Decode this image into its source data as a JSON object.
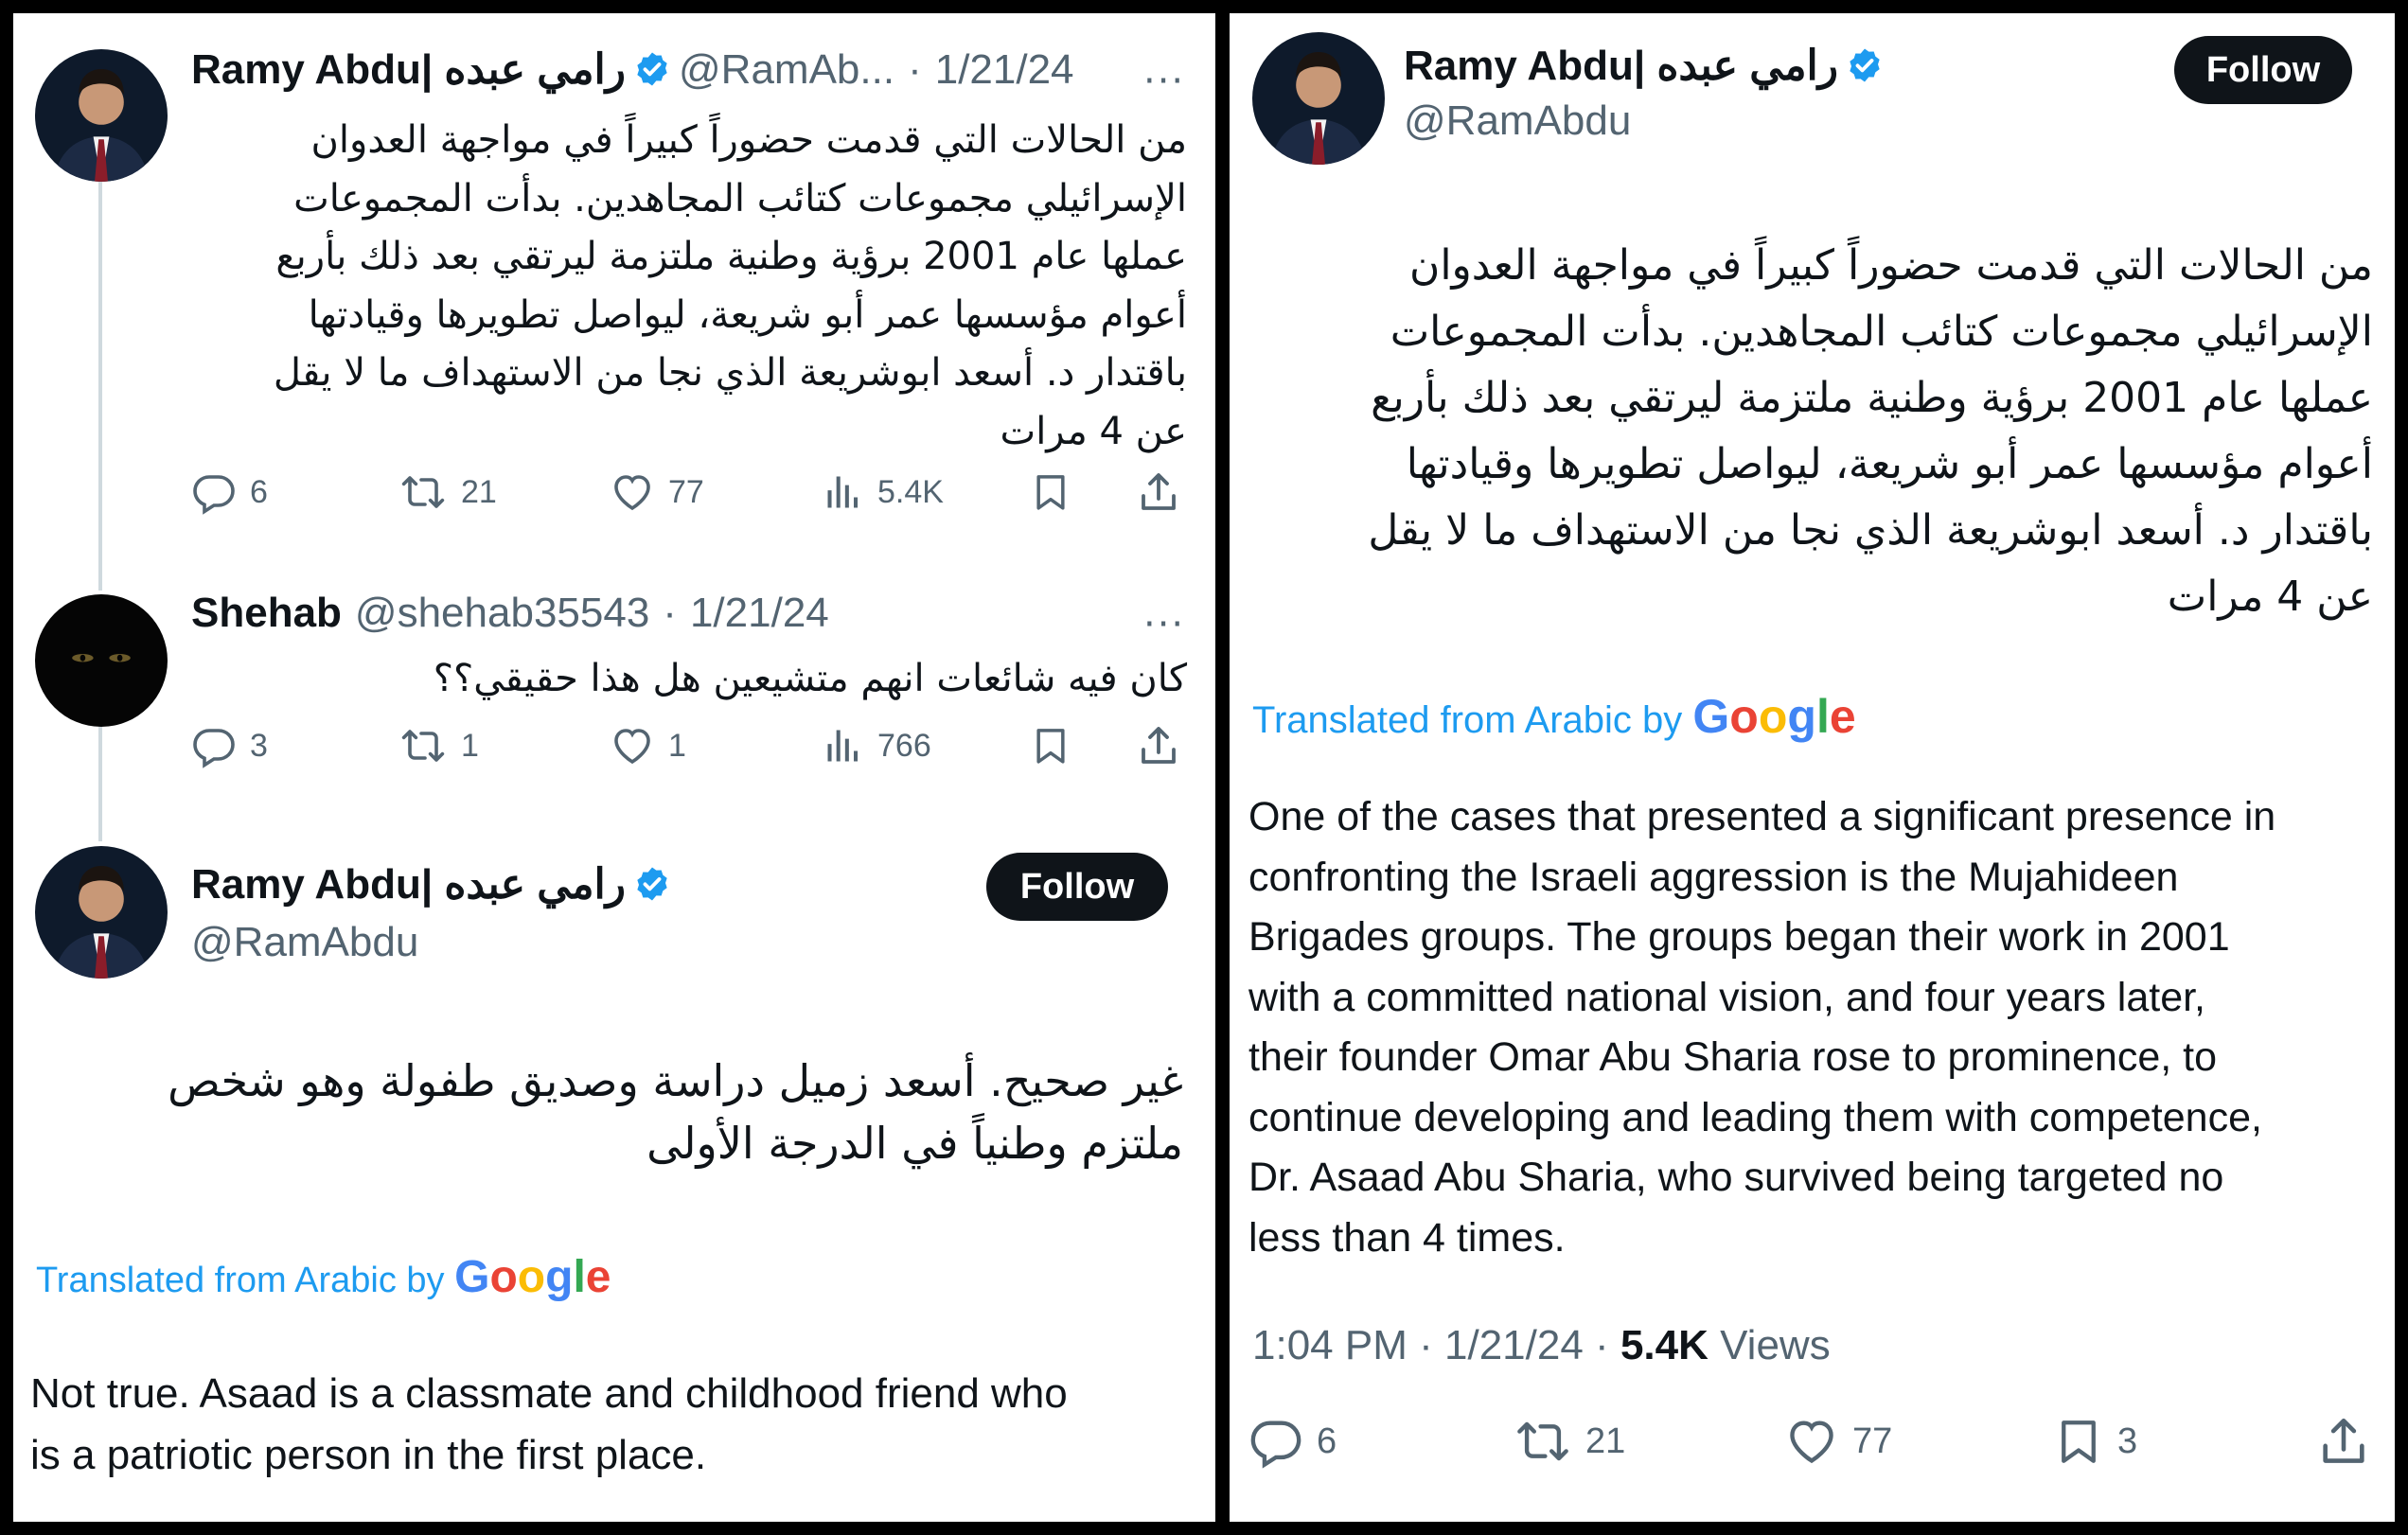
{
  "left": {
    "tweet1": {
      "name": "Ramy Abdu| رامي عبده",
      "handle": "@RamAb...",
      "separator": "·",
      "date": "1/21/24",
      "more": "···",
      "text": "من الحالات التي قدمت حضوراً كبيراً في مواجهة العدوان\nالإسرائيلي مجموعات كتائب المجاهدين. بدأت المجموعات\nعملها عام 2001 برؤية وطنية ملتزمة ليرتقي بعد ذلك بأربع\nأعوام مؤسسها عمر أبو شريعة، ليواصل تطويرها وقيادتها\nباقتدار  د. أسعد ابوشريعة الذي نجا من الاستهداف ما لا يقل\nعن 4 مرات",
      "actions": {
        "replies": "6",
        "reposts": "21",
        "likes": "77",
        "views": "5.4K"
      }
    },
    "tweet2": {
      "name": "Shehab",
      "handle": "@shehab35543",
      "separator": "·",
      "date": "1/21/24",
      "more": "···",
      "text": "كان فيه شائعات انهم متشيعين هل هذا حقيقي؟؟",
      "actions": {
        "replies": "3",
        "reposts": "1",
        "likes": "1",
        "views": "766"
      }
    },
    "tweet3": {
      "name": "Ramy Abdu| رامي عبده",
      "handle": "@RamAbdu",
      "follow_label": "Follow",
      "text": "غير صحيح. أسعد زميل دراسة وصديق طفولة وهو شخص\nملتزم وطنياً في الدرجة الأولى",
      "translated_prefix": "Translated from Arabic by",
      "translation": "Not true. Asaad is a classmate and childhood friend who\nis a patriotic person in the first place."
    }
  },
  "right": {
    "name": "Ramy Abdu| رامي عبده",
    "handle": "@RamAbdu",
    "follow_label": "Follow",
    "text": "من الحالات التي قدمت حضوراً كبيراً في مواجهة العدوان\nالإسرائيلي مجموعات كتائب المجاهدين. بدأت المجموعات\nعملها عام 2001 برؤية وطنية ملتزمة ليرتقي بعد ذلك بأربع\nأعوام مؤسسها عمر أبو شريعة، ليواصل تطويرها وقيادتها\nباقتدار  د. أسعد ابوشريعة الذي نجا من الاستهداف ما لا يقل\nعن 4 مرات",
    "translated_prefix": "Translated from Arabic by",
    "translation": "One of the cases that presented a significant presence in\nconfronting the Israeli aggression is the Mujahideen\nBrigades groups. The groups began their work in 2001\nwith a committed national vision, and four years later,\ntheir founder Omar Abu Sharia rose to prominence, to\ncontinue developing and leading them with competence,\nDr. Asaad Abu Sharia, who survived being targeted no\nless than 4 times.",
    "time": "1:04 PM",
    "separator": "·",
    "date": "1/21/24",
    "views_count": "5.4K",
    "views_label": "Views",
    "actions": {
      "replies": "6",
      "reposts": "21",
      "likes": "77",
      "bookmarks": "3"
    }
  },
  "google_logo": {
    "letters": [
      "G",
      "o",
      "o",
      "g",
      "l",
      "e"
    ],
    "colors": [
      "#4285F4",
      "#EA4335",
      "#FBBC05",
      "#4285F4",
      "#34A853",
      "#EA4335"
    ]
  },
  "colors": {
    "verified": "#1d9bf0",
    "link": "#1d9bf0",
    "muted": "#536471",
    "text": "#0f1419",
    "follow_bg": "#0f1419"
  },
  "icons": [
    "reply-icon",
    "repost-icon",
    "like-icon",
    "views-icon",
    "bookmark-icon",
    "share-icon",
    "verified-badge-icon",
    "more-icon"
  ]
}
